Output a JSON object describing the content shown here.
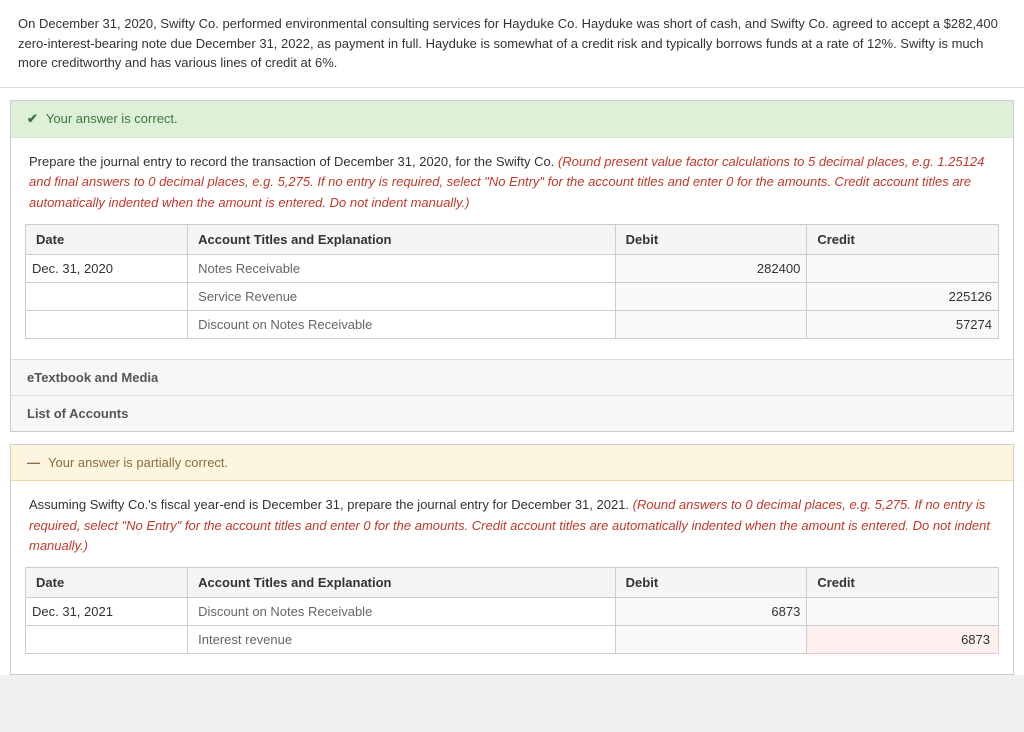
{
  "problem": {
    "text": "On December 31, 2020, Swifty Co. performed environmental consulting services for Hayduke Co. Hayduke was short of cash, and Swifty Co. agreed to accept a $282,400 zero-interest-bearing note due December 31, 2022, as payment in full. Hayduke is somewhat of a credit risk and typically borrows funds at a rate of 12%. Swifty is much more creditworthy and has various lines of credit at 6%."
  },
  "section1": {
    "status": "Your answer is correct.",
    "status_type": "correct",
    "instruction_plain": "Prepare the journal entry to record the transaction of December 31, 2020, for the Swifty Co.",
    "instruction_italic": "(Round present value factor calculations to 5 decimal places, e.g. 1.25124 and final answers to 0 decimal places, e.g. 5,275. If no entry is required, select \"No Entry\" for the account titles and enter 0 for the amounts. Credit account titles are automatically indented when the amount is entered. Do not indent manually.)",
    "table": {
      "headers": [
        "Date",
        "Account Titles and Explanation",
        "Debit",
        "Credit"
      ],
      "rows": [
        {
          "date": "Dec. 31, 2020",
          "account": "Notes Receivable",
          "debit": "282400",
          "credit": "",
          "debit_highlighted": false,
          "credit_highlighted": false
        },
        {
          "date": "",
          "account": "Service Revenue",
          "debit": "",
          "credit": "225126",
          "debit_highlighted": false,
          "credit_highlighted": false
        },
        {
          "date": "",
          "account": "Discount on Notes Receivable",
          "debit": "",
          "credit": "57274",
          "debit_highlighted": false,
          "credit_highlighted": false
        }
      ]
    },
    "etextbook_label": "eTextbook and Media",
    "list_accounts_label": "List of Accounts"
  },
  "section2": {
    "status": "Your answer is partially correct.",
    "status_type": "partial",
    "instruction_plain": "Assuming Swifty Co.'s fiscal year-end is December 31, prepare the journal entry for December 31, 2021.",
    "instruction_italic": "(Round answers to 0 decimal places, e.g. 5,275. If no entry is required, select \"No Entry\" for the account titles and enter 0 for the amounts. Credit account titles are automatically indented when the amount is entered. Do not indent manually.)",
    "table": {
      "headers": [
        "Date",
        "Account Titles and Explanation",
        "Debit",
        "Credit"
      ],
      "rows": [
        {
          "date": "Dec. 31, 2021",
          "account": "Discount on Notes Receivable",
          "debit": "6873",
          "credit": "",
          "debit_highlighted": false,
          "credit_highlighted": false
        },
        {
          "date": "",
          "account": "Interest revenue",
          "debit": "",
          "credit": "6873",
          "debit_highlighted": false,
          "credit_highlighted": true
        }
      ]
    }
  },
  "icons": {
    "check": "✔",
    "minus": "—"
  }
}
